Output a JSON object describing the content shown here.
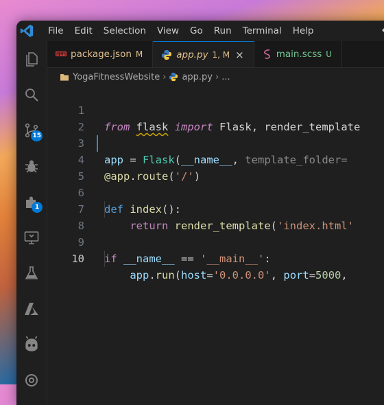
{
  "menubar": {
    "items": [
      "File",
      "Edit",
      "Selection",
      "View",
      "Go",
      "Run",
      "Terminal",
      "Help"
    ],
    "overflow": "⇦"
  },
  "activity_bar": {
    "items": [
      {
        "name": "explorer-icon"
      },
      {
        "name": "search-icon"
      },
      {
        "name": "source-control-icon",
        "badge": "15"
      },
      {
        "name": "run-debug-icon"
      },
      {
        "name": "extensions-icon",
        "badge": "1"
      },
      {
        "name": "remote-explorer-icon"
      },
      {
        "name": "testing-icon"
      },
      {
        "name": "azure-icon"
      },
      {
        "name": "copilot-icon"
      },
      {
        "name": "openai-icon"
      }
    ]
  },
  "tabs": [
    {
      "label": "package.json",
      "mark": "M",
      "active": false,
      "color": "#e2c08d",
      "icon": "npm-icon"
    },
    {
      "label": "app.py",
      "mark": "1, M",
      "active": true,
      "color": "#e2c08d",
      "icon": "python-icon",
      "close": "×"
    },
    {
      "label": "main.scss",
      "mark": "U",
      "active": false,
      "color": "#73c991",
      "icon": "sass-icon"
    }
  ],
  "breadcrumb": {
    "folder": "YogaFitnessWebsite",
    "file": "app.py",
    "ellipsis": "..."
  },
  "editor": {
    "current_line": 10,
    "lines": [
      {
        "n": "1"
      },
      {
        "n": "2"
      },
      {
        "n": "3"
      },
      {
        "n": "4"
      },
      {
        "n": "5"
      },
      {
        "n": "6"
      },
      {
        "n": "7"
      },
      {
        "n": "8"
      },
      {
        "n": "9"
      },
      {
        "n": "10"
      }
    ],
    "tokens": {
      "l1_from": "from",
      "l1_flask": "flask",
      "l1_import": "import",
      "l1_rest": "Flask, render_template",
      "l2_app": "app",
      "l2_eq": " = ",
      "l2_Flask": "Flask",
      "l2_paren": "(",
      "l2_name": "__name__",
      "l2_comma": ", ",
      "l2_tf": "template_folder=",
      "l4_at": "@",
      "l4_app": "app",
      "l4_dot": ".",
      "l4_route": "route",
      "l4_p1": "(",
      "l4_str": "'/'",
      "l4_p2": ")",
      "l6_def": "def",
      "l6_index": "index",
      "l6_parens": "():",
      "l7_return": "return",
      "l7_fn": "render_template",
      "l7_p": "(",
      "l7_str": "'index.html'",
      "l9_if": "if",
      "l9_name": "__name__",
      "l9_eq": " == ",
      "l9_str": "'__main__'",
      "l9_colon": ":",
      "l10_app": "app",
      "l10_dot": ".",
      "l10_run": "run",
      "l10_p": "(",
      "l10_host": "host",
      "l10_eq1": "=",
      "l10_hstr": "'0.0.0.0'",
      "l10_comma": ", ",
      "l10_port": "port",
      "l10_eq2": "=",
      "l10_num": "5000",
      "l10_tail": ", "
    }
  },
  "colors": {
    "accent": "#0078d4",
    "modified": "#e2c08d",
    "untracked": "#73c991"
  }
}
